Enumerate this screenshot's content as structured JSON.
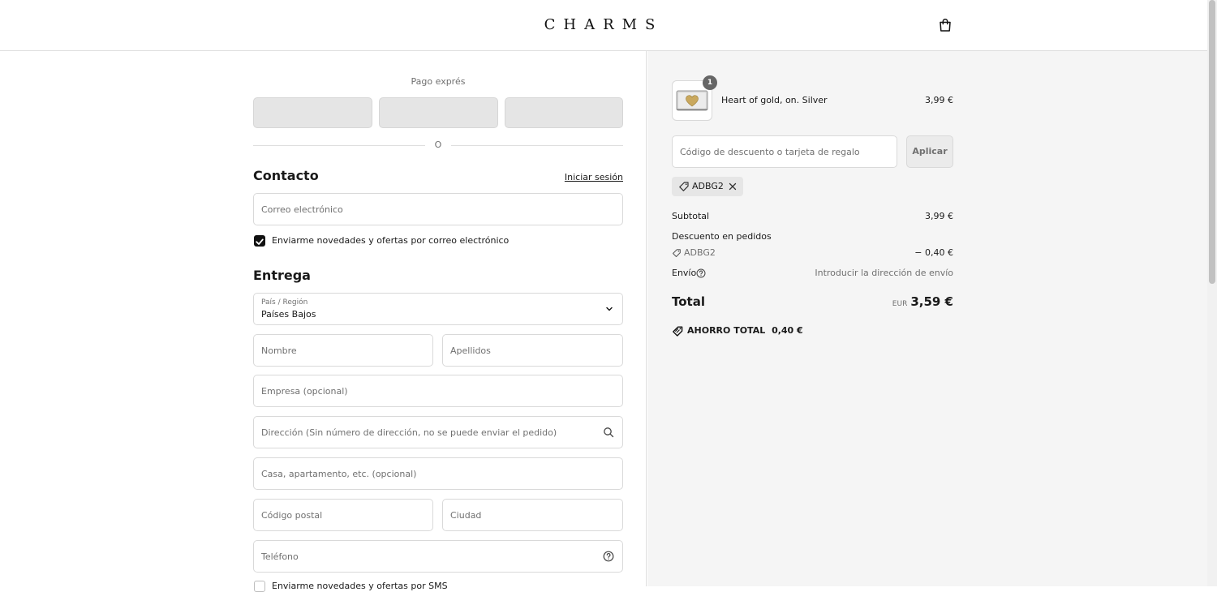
{
  "header": {
    "logo": "CHARMS",
    "cart_icon": "shopping-bag-icon"
  },
  "express": {
    "title": "Pago exprés",
    "divider": "O"
  },
  "contact": {
    "title": "Contacto",
    "login_link": "Iniciar sesión",
    "email_placeholder": "Correo electrónico",
    "newsletter_label": "Enviarme novedades y ofertas por correo electrónico",
    "newsletter_checked": true
  },
  "delivery": {
    "title": "Entrega",
    "country_label": "País / Región",
    "country_value": "Países Bajos",
    "first_name_placeholder": "Nombre",
    "last_name_placeholder": "Apellidos",
    "company_placeholder": "Empresa (opcional)",
    "address_placeholder": "Dirección (Sin número de dirección, no se puede enviar el pedido)",
    "apartment_placeholder": "Casa, apartamento, etc. (opcional)",
    "postal_placeholder": "Código postal",
    "city_placeholder": "Ciudad",
    "phone_placeholder": "Teléfono",
    "sms_label": "Enviarme novedades y ofertas por SMS"
  },
  "summary": {
    "product": {
      "name": "Heart of gold, on. Silver",
      "price": "3,99 €",
      "quantity": "1"
    },
    "discount_placeholder": "Código de descuento o tarjeta de regalo",
    "apply_label": "Aplicar",
    "applied_code": "ADBG2",
    "subtotal_label": "Subtotal",
    "subtotal_value": "3,99 €",
    "order_discount_label": "Descuento en pedidos",
    "order_discount_code": "ADBG2",
    "order_discount_value": "− 0,40 €",
    "shipping_label": "Envío",
    "shipping_value": "Introducir la dirección de envío",
    "total_label": "Total",
    "currency": "EUR",
    "total_value": "3,59 €",
    "savings_label": "AHORRO TOTAL",
    "savings_value": "0,40 €"
  },
  "colors": {
    "accent": "#111111",
    "sidebar_bg": "#f5f5f5",
    "border": "#d9d9d9"
  }
}
